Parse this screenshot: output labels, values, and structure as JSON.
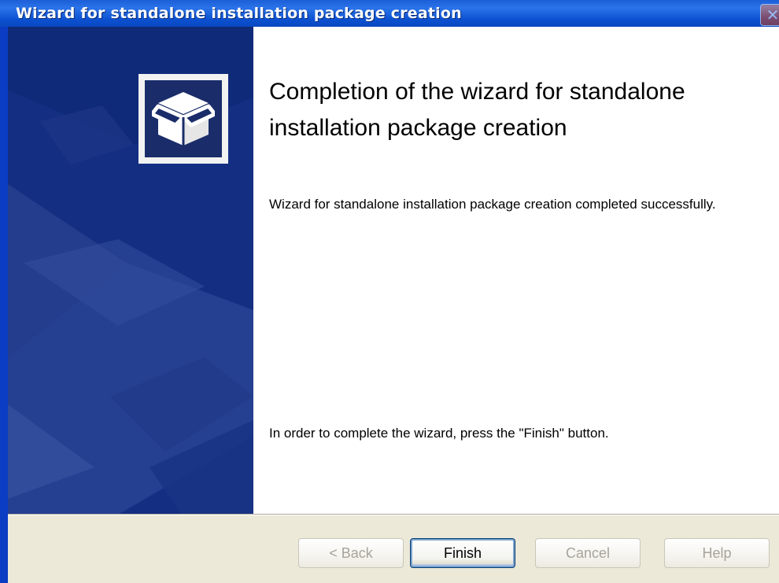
{
  "window": {
    "title": "Wizard for standalone installation package creation",
    "close_glyph": "✕"
  },
  "side_panel": {
    "icon": "package-box-icon"
  },
  "content": {
    "heading": "Completion of the wizard for standalone installation package creation",
    "status_text": "Wizard for standalone installation package creation completed successfully.",
    "finish_hint": "In order to complete the wizard, press the \"Finish\" button."
  },
  "buttons": {
    "back": "< Back",
    "finish": "Finish",
    "cancel": "Cancel",
    "help": "Help"
  },
  "colors": {
    "titlebar": "#0b50d0",
    "side_panel": "#0f2a78",
    "footer": "#ece9d8"
  }
}
